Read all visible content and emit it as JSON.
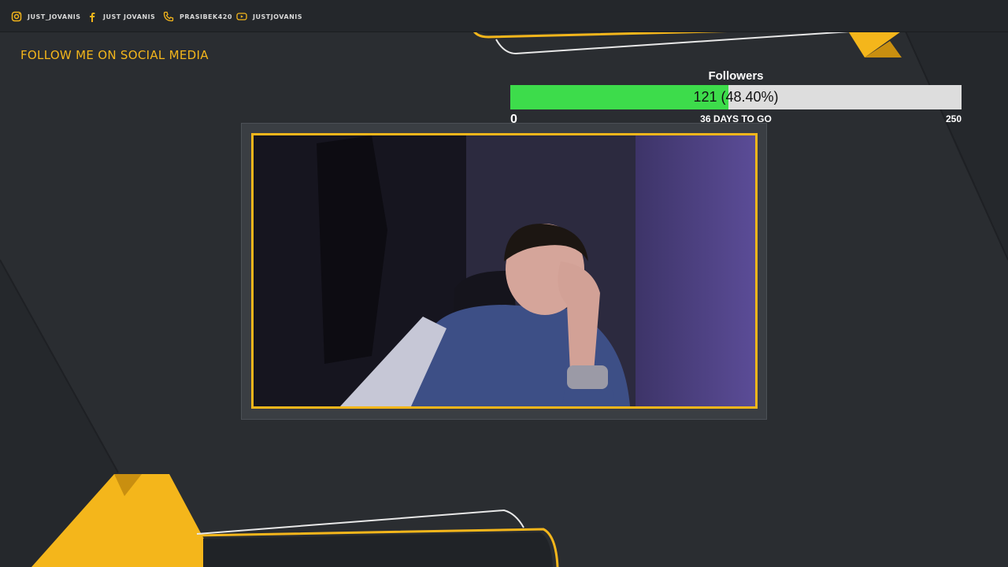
{
  "colors": {
    "accent": "#f4b61b",
    "progress_fill": "#3ddc4b",
    "progress_track": "#dddddd",
    "background": "#2a2d31"
  },
  "social_links": [
    {
      "icon": "instagram-icon",
      "label": "Just_Jovanis"
    },
    {
      "icon": "facebook-icon",
      "label": "Just Jovanis"
    },
    {
      "icon": "phone-icon",
      "label": "prasibek420"
    },
    {
      "icon": "youtube-icon",
      "label": "justjovanis"
    }
  ],
  "follow_banner": "FOLLOW ME ON SOCIAL MEDIA",
  "goal": {
    "title": "Followers",
    "value_label": "121 (48.40%)",
    "current": 121,
    "min": "0",
    "max": "250",
    "progress_fraction": 0.484,
    "days_label": "36 DAYS TO GO"
  },
  "webcam": {
    "subject": "person-at-desk"
  }
}
